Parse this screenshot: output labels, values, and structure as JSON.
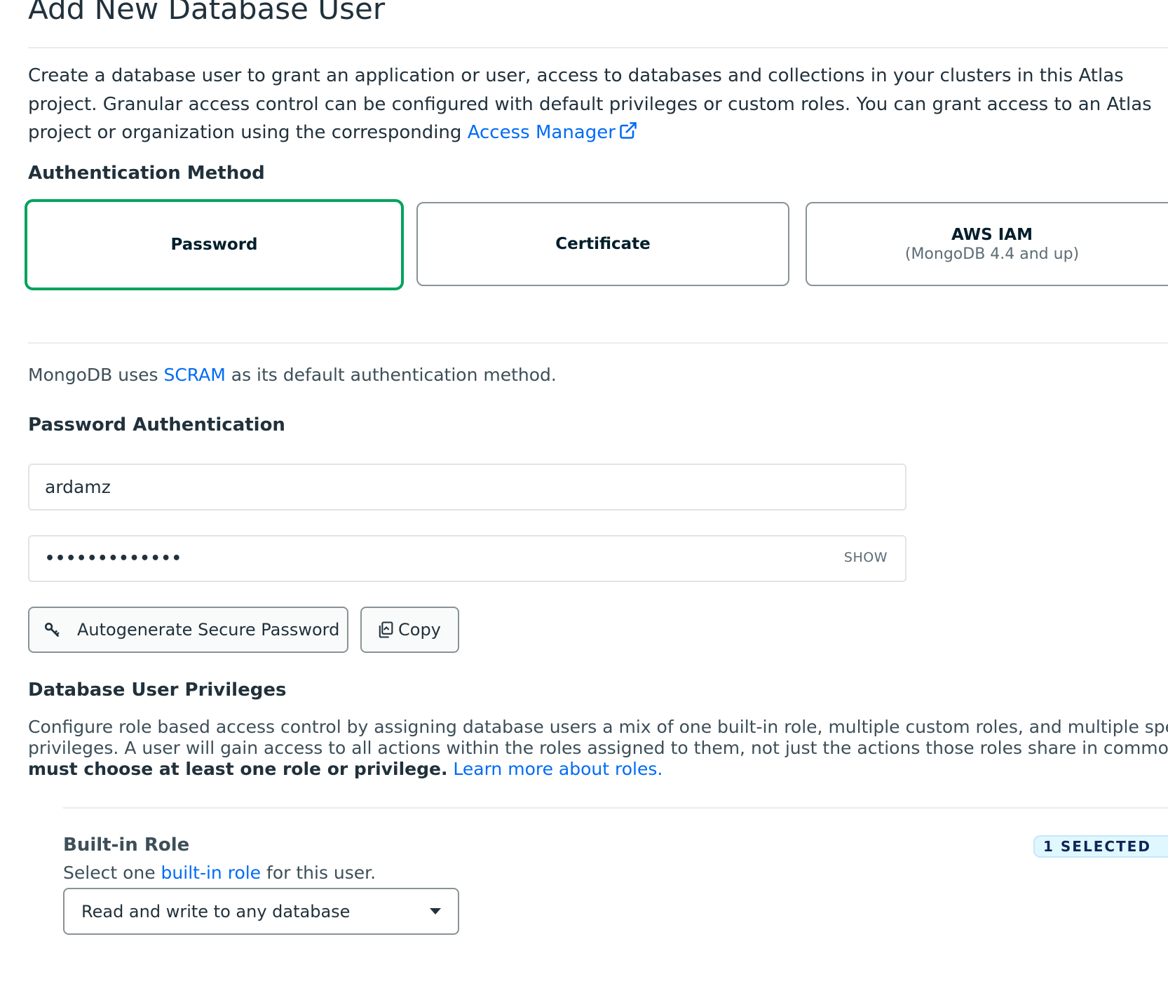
{
  "page": {
    "title": "Add New Database User"
  },
  "intro": {
    "line1": "Create a database user to grant an application or user, access to databases and collections in your clusters in this Atlas",
    "line2": "project. Granular access control can be configured with default privileges or custom roles. You can grant access to an Atlas",
    "line3_prefix": "project or organization using the corresponding ",
    "access_manager_link": "Access Manager"
  },
  "auth_method": {
    "heading": "Authentication Method",
    "options": [
      {
        "label": "Password",
        "sub": "",
        "selected": true
      },
      {
        "label": "Certificate",
        "sub": "",
        "selected": false
      },
      {
        "label": "AWS IAM",
        "sub": "(MongoDB 4.4 and up)",
        "selected": false
      }
    ]
  },
  "scram_note": {
    "prefix": "MongoDB uses ",
    "link": "SCRAM",
    "suffix": " as its default authentication method."
  },
  "password_auth": {
    "heading": "Password Authentication",
    "username_value": "ardamz",
    "password_value": "•••••••••••••",
    "show_label": "SHOW",
    "autogenerate_label": "Autogenerate Secure Password",
    "copy_label": "Copy"
  },
  "privileges": {
    "heading": "Database User Privileges",
    "line1": "Configure role based access control by assigning database users a mix of one built-in role, multiple custom roles, and multiple specific",
    "line2": "privileges. A user will gain access to all actions within the roles assigned to them, not just the actions those roles share in common. You",
    "line3_bold": "must choose at least one role or privilege.",
    "learn_more_link": "Learn more about roles."
  },
  "built_in_role": {
    "title": "Built-in Role",
    "sub_prefix": "Select one ",
    "sub_link": "built-in role",
    "sub_suffix": " for this user.",
    "badge": "1 SELECTED",
    "selected_value": "Read and write to any database"
  },
  "colors": {
    "accent_green": "#00a35c",
    "link_blue": "#016bf8",
    "text_dark": "#21313c",
    "border_gray": "#889397"
  },
  "icons": {
    "external_link": "external-link-icon",
    "key": "key-icon",
    "copy": "copy-icon",
    "dropdown": "caret-down-icon"
  }
}
